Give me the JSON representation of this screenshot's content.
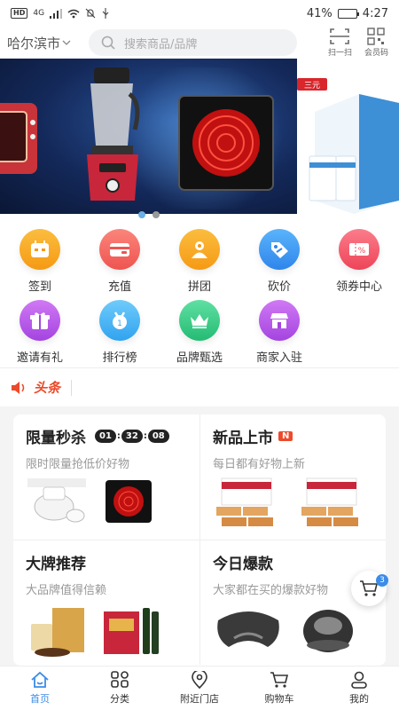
{
  "status_bar": {
    "network": "4G",
    "battery": "41%",
    "battery_level": 0.41,
    "time": "4:27"
  },
  "header": {
    "city": "哈尔滨市",
    "search_placeholder": "搜索商品/品牌",
    "scan_label": "扫一扫",
    "member_code_label": "会员码"
  },
  "banner": {
    "slide_count": 2,
    "active_index": 0,
    "brand_text": "三元"
  },
  "grid": [
    {
      "label": "签到",
      "icon": "calendar-icon",
      "color": "#f7a623"
    },
    {
      "label": "充值",
      "icon": "wallet-icon",
      "color": "#f5675e"
    },
    {
      "label": "拼团",
      "icon": "group-icon",
      "color": "#f7a623"
    },
    {
      "label": "砍价",
      "icon": "price-tag-icon",
      "color": "#3d9bf0"
    },
    {
      "label": "领券中心",
      "icon": "coupon-icon",
      "color": "#f25a6b"
    },
    {
      "label": "邀请有礼",
      "icon": "gift-icon",
      "color": "#b458e6"
    },
    {
      "label": "排行榜",
      "icon": "ranking-icon",
      "color": "#45b4f2"
    },
    {
      "label": "品牌甄选",
      "icon": "crown-icon",
      "color": "#3fcf8a"
    },
    {
      "label": "商家入驻",
      "icon": "store-icon",
      "color": "#b458e6"
    }
  ],
  "headline": {
    "label": "头条"
  },
  "promo": {
    "flash": {
      "title": "限量秒杀",
      "subtitle": "限时限量抢低价好物",
      "timer": [
        "01",
        "32",
        "08"
      ]
    },
    "new": {
      "title": "新品上市",
      "tag": "N",
      "subtitle": "每日都有好物上新"
    },
    "brand": {
      "title": "大牌推荐",
      "subtitle": "大品牌值得信赖"
    },
    "hot": {
      "title": "今日爆款",
      "subtitle": "大家都在买的爆款好物"
    }
  },
  "floating_cart": {
    "count": "3"
  },
  "tabs": [
    {
      "label": "首页",
      "icon": "home-icon",
      "active": true
    },
    {
      "label": "分类",
      "icon": "category-icon",
      "active": false
    },
    {
      "label": "附近门店",
      "icon": "location-icon",
      "active": false
    },
    {
      "label": "购物车",
      "icon": "cart-icon",
      "active": false
    },
    {
      "label": "我的",
      "icon": "user-icon",
      "active": false
    }
  ],
  "colors": {
    "accent": "#3c8ce7",
    "red": "#ec4a2a"
  }
}
